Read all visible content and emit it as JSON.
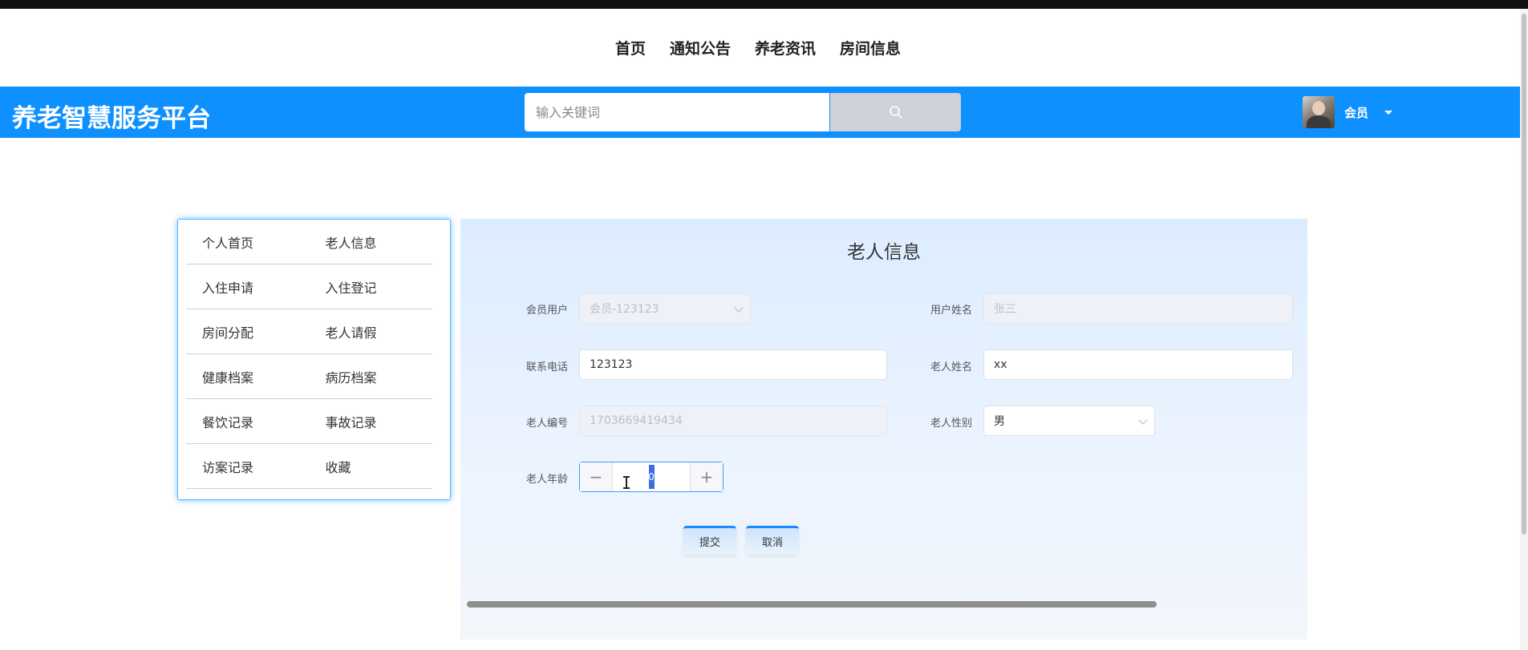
{
  "top_nav": {
    "items": [
      {
        "label": "首页"
      },
      {
        "label": "通知公告"
      },
      {
        "label": "养老资讯"
      },
      {
        "label": "房间信息"
      }
    ]
  },
  "header": {
    "brand": "养老智慧服务平台",
    "search_placeholder": "输入关键词",
    "user_label": "会员",
    "search_icon": "search-icon",
    "accent_color": "#0e90ff"
  },
  "side_menu": {
    "rows": [
      [
        "个人首页",
        "老人信息"
      ],
      [
        "入住申请",
        "入住登记"
      ],
      [
        "房间分配",
        "老人请假"
      ],
      [
        "健康档案",
        "病历档案"
      ],
      [
        "餐饮记录",
        "事故记录"
      ],
      [
        "访案记录",
        "收藏"
      ]
    ]
  },
  "form": {
    "title": "老人信息",
    "member_user": {
      "label": "会员用户",
      "value": "会员-123123"
    },
    "user_name": {
      "label": "用户姓名",
      "value": "张三"
    },
    "phone": {
      "label": "联系电话",
      "value": "123123"
    },
    "elder_name": {
      "label": "老人姓名",
      "value": "xx"
    },
    "elder_no": {
      "label": "老人编号",
      "value": "1703669419434"
    },
    "elder_gender": {
      "label": "老人性别",
      "value": "男"
    },
    "elder_age": {
      "label": "老人年龄",
      "value": "0",
      "minus": "−",
      "plus": "+"
    },
    "submit_label": "提交",
    "cancel_label": "取消"
  }
}
